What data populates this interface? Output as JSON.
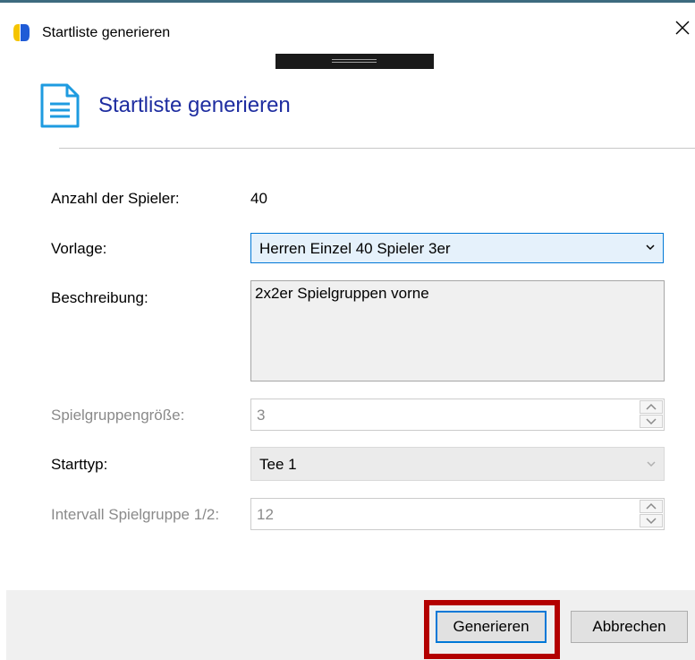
{
  "window": {
    "title": "Startliste generieren",
    "close_glyph": "✕"
  },
  "header": {
    "title": "Startliste generieren",
    "icon": "document-icon",
    "accent_color": "#1e2da0"
  },
  "form": {
    "player_count_label": "Anzahl der Spieler:",
    "player_count_value": "40",
    "template_label": "Vorlage:",
    "template_value": "Herren Einzel 40 Spieler 3er",
    "description_label": "Beschreibung:",
    "description_value": "2x2er Spielgruppen vorne",
    "group_size_label": "Spielgruppengröße:",
    "group_size_value": "3",
    "start_type_label": "Starttyp:",
    "start_type_value": "Tee 1",
    "interval_label": "Intervall Spielgruppe 1/2:",
    "interval_value": "12"
  },
  "footer": {
    "generate_label": "Generieren",
    "cancel_label": "Abbrechen",
    "highlight_color": "#b30000"
  }
}
